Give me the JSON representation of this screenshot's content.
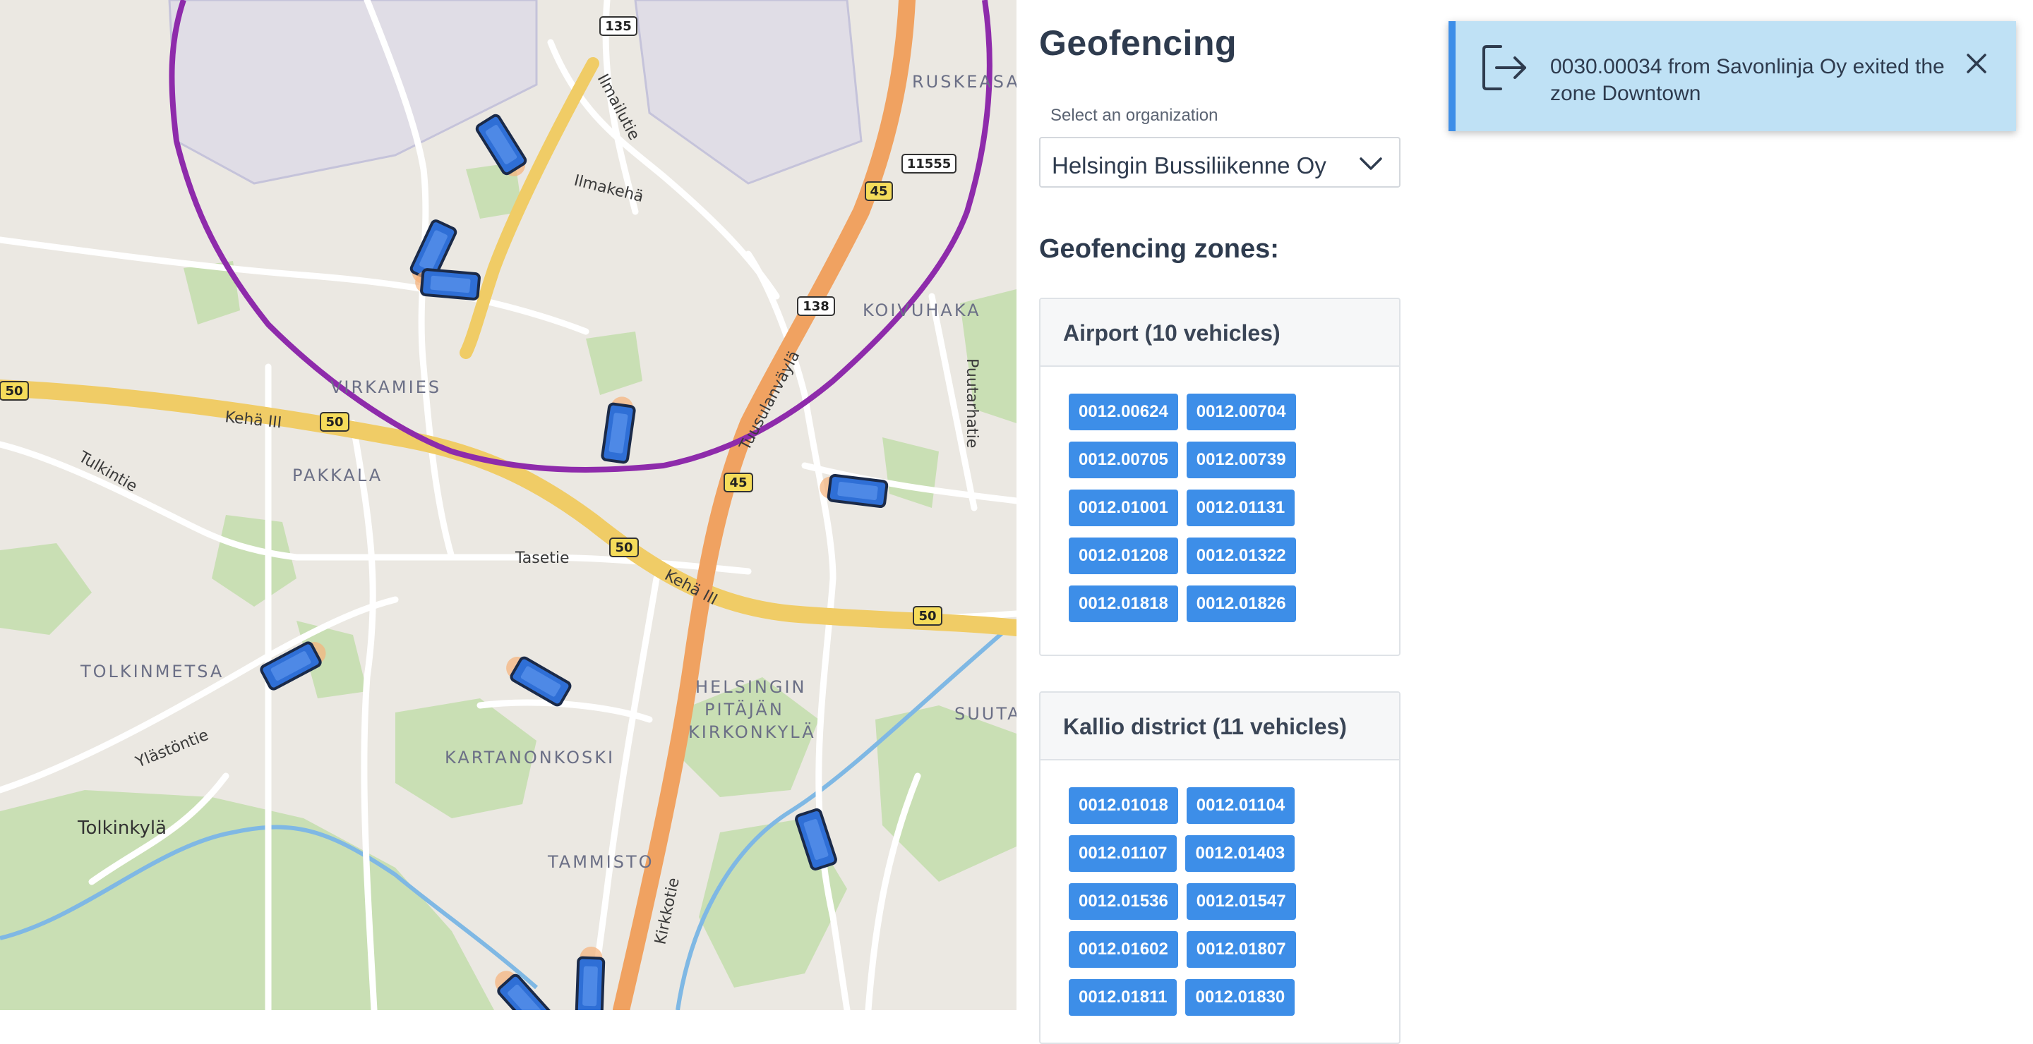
{
  "sidebar": {
    "title": "Geofencing",
    "organization_label": "Select an organization",
    "organization_value": "Helsingin Bussiliikenne Oy",
    "zones_heading": "Geofencing zones:",
    "zones": [
      {
        "name": "Airport (10 vehicles)",
        "vehicles": [
          "0012.00624",
          "0012.00704",
          "0012.00705",
          "0012.00739",
          "0012.01001",
          "0012.01131",
          "0012.01208",
          "0012.01322",
          "0012.01818",
          "0012.01826"
        ]
      },
      {
        "name": "Kallio district (11 vehicles)",
        "vehicles": [
          "0012.01018",
          "0012.01104",
          "0012.01107",
          "0012.01403",
          "0012.01536",
          "0012.01547",
          "0012.01602",
          "0012.01807",
          "0012.01811",
          "0012.01830"
        ]
      }
    ]
  },
  "notification": {
    "message": "0030.00034 from Savonlinja Oy exited the zone Downtown",
    "icon": "exit-icon",
    "accent": "#3d8ee8",
    "background": "#bfe1f5"
  },
  "map": {
    "place_labels": [
      "RUSKEASANTA",
      "KOIVUHAKA",
      "VIRKAMIES",
      "PAKKALA",
      "TOLKINMETSA",
      "HELSINGIN",
      "PITÄJÄN",
      "KIRKONKYLÄ",
      "KARTANONKOSKI",
      "TAMMISTO",
      "SUUTARILA",
      "Tolkinkylä"
    ],
    "street_labels": [
      "Ilmailutie",
      "Ilmakehä",
      "Kehä III",
      "Tulkintie",
      "Tasetie",
      "Ylästöntie",
      "Tuusulanväylä",
      "Puutarhatie",
      "Kirkkotie"
    ],
    "road_shields": [
      "135",
      "11555",
      "45",
      "138",
      "50",
      "50",
      "45",
      "50",
      "50"
    ],
    "zone_color": "#8e2bab",
    "bus_color": "#2f6fd6"
  }
}
